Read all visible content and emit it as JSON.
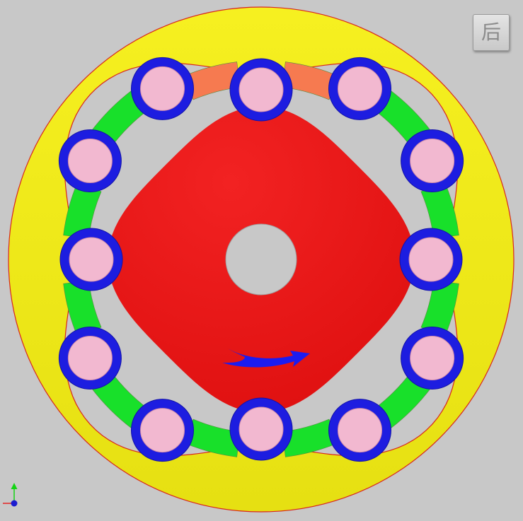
{
  "view_cube": {
    "label": "后"
  },
  "colors": {
    "background": "#c8c8c8",
    "outer_ring": "#f4ee1c",
    "outer_ring_edge": "#d8261c",
    "cam": "#ec1616",
    "roller_ring": "#1d1de0",
    "roller_core": "#f2b8d0",
    "separator": "#18e02a",
    "separator_highlight": "#f67a50",
    "rotation_arrow": "#1c1cf0",
    "axis_y": "#14d414",
    "axis_x": "#e42222",
    "axis_z": "#1c1cd0"
  },
  "mechanism": {
    "roller_count": 12,
    "highlighted_separators": [
      0,
      11
    ],
    "rotation": "clockwise"
  }
}
